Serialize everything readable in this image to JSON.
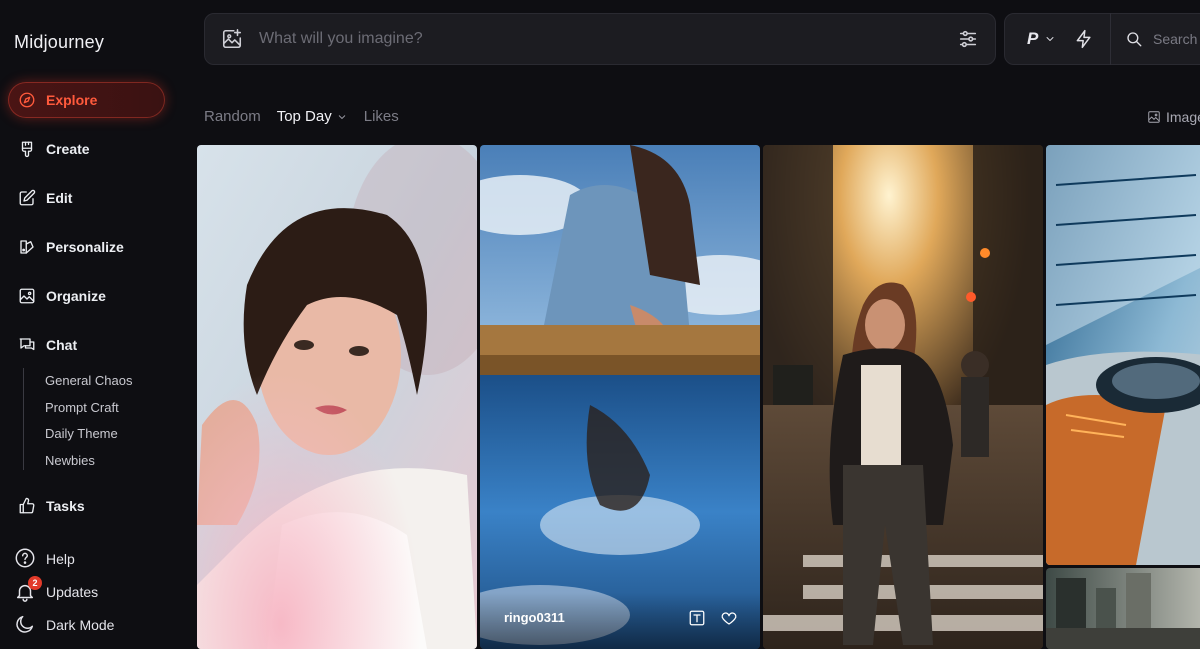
{
  "app": {
    "title": "Midjourney"
  },
  "sidebar": {
    "items": [
      {
        "label": "Explore",
        "icon": "compass-icon"
      },
      {
        "label": "Create",
        "icon": "brush-icon"
      },
      {
        "label": "Edit",
        "icon": "edit-icon"
      },
      {
        "label": "Personalize",
        "icon": "personalize-icon"
      },
      {
        "label": "Organize",
        "icon": "image-gallery-icon"
      },
      {
        "label": "Chat",
        "icon": "chat-icon"
      },
      {
        "label": "Tasks",
        "icon": "thumbs-up-icon"
      }
    ],
    "chat_rooms": [
      "General Chaos",
      "Prompt Craft",
      "Daily Theme",
      "Newbies"
    ],
    "footer": {
      "help": "Help",
      "updates": "Updates",
      "updates_badge": "2",
      "dark_mode": "Dark Mode"
    }
  },
  "prompt": {
    "placeholder": "What will you imagine?"
  },
  "toolbar": {
    "personalize_label": "P",
    "search_placeholder": "Search"
  },
  "filters": {
    "random": "Random",
    "top_day": "Top Day",
    "likes": "Likes",
    "images_toggle": "Images"
  },
  "gallery": {
    "cards": [
      {
        "id": "portrait-woman"
      },
      {
        "id": "reflection-hand",
        "author": "ringo0311"
      },
      {
        "id": "street-walk"
      },
      {
        "id": "futuristic-car"
      },
      {
        "id": "city-street"
      }
    ]
  },
  "colors": {
    "accent": "#ff5a3c",
    "background": "#0e0e12",
    "panel": "#1c1c21"
  }
}
